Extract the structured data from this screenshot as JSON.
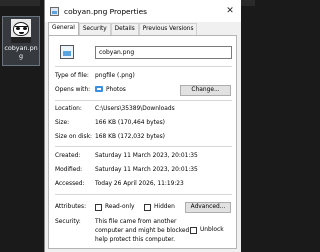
{
  "desktop": {
    "icon_label": "cobyan.png"
  },
  "window": {
    "title": "cobyan.png Properties",
    "close_glyph": "✕",
    "tabs": [
      "General",
      "Security",
      "Details",
      "Previous Versions"
    ],
    "active_tab": "General"
  },
  "general": {
    "file_name": "cobyan.png",
    "type_label": "Type of file:",
    "type_value": "pngfile (.png)",
    "opens_label": "Opens with:",
    "opens_value": "Photos",
    "change_button": "Change...",
    "location_label": "Location:",
    "location_value": "C:\\Users\\35389\\Downloads",
    "size_label": "Size:",
    "size_value": "166 KB (170,464 bytes)",
    "size_disk_label": "Size on disk:",
    "size_disk_value": "168 KB (172,032 bytes)",
    "created_label": "Created:",
    "created_value": "Saturday 11 March 2023, 20:01:35",
    "modified_label": "Modified:",
    "modified_value": "Saturday 11 March 2023, 20:01:35",
    "accessed_label": "Accessed:",
    "accessed_value": "Today 26 April 2026, 11:19:23",
    "attributes_label": "Attributes:",
    "readonly_label": "Read-only",
    "hidden_label": "Hidden",
    "advanced_button": "Advanced...",
    "security_label": "Security:",
    "security_text_1": "This file came from another",
    "security_text_2": "computer and might be blocked to",
    "security_text_3": "help protect this computer.",
    "unblock_label": "Unblock"
  }
}
